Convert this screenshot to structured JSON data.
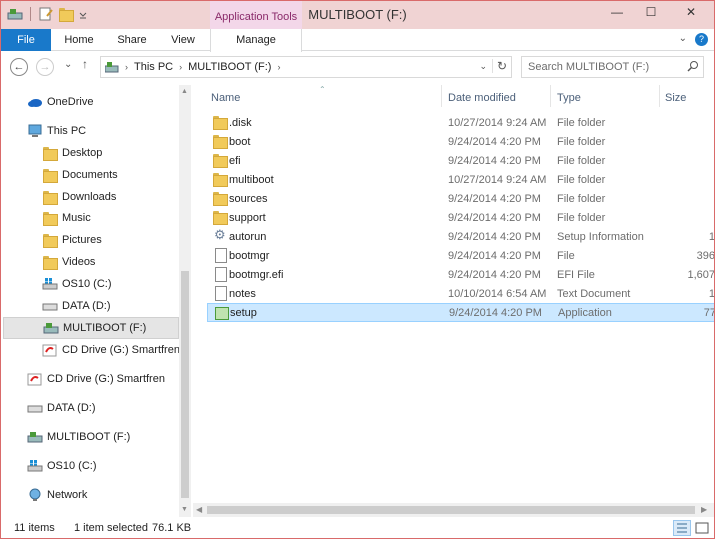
{
  "window": {
    "title": "MULTIBOOT (F:)",
    "context_tab_group": "Application Tools",
    "minimize": "—",
    "maximize": "☐",
    "close": "✕"
  },
  "ribbon": {
    "tabs": [
      "File",
      "Home",
      "Share",
      "View",
      "Manage"
    ],
    "collapse_icon": "⌄",
    "help_icon": "?"
  },
  "address": {
    "back": "←",
    "forward": "→",
    "recent": "⌄",
    "up": "↑",
    "crumbs": [
      "This PC",
      "MULTIBOOT (F:)"
    ],
    "crumb_sep": "›",
    "dropdown": "⌄",
    "refresh": "↻"
  },
  "search": {
    "placeholder": "Search MULTIBOOT (F:)"
  },
  "nav": {
    "items": [
      {
        "label": "OneDrive",
        "icon": "cloud-icon"
      },
      {
        "label": "This PC",
        "icon": "computer-icon"
      },
      {
        "label": "Desktop",
        "icon": "folder-icon"
      },
      {
        "label": "Documents",
        "icon": "folder-icon"
      },
      {
        "label": "Downloads",
        "icon": "folder-icon"
      },
      {
        "label": "Music",
        "icon": "folder-icon"
      },
      {
        "label": "Pictures",
        "icon": "folder-icon"
      },
      {
        "label": "Videos",
        "icon": "folder-icon"
      },
      {
        "label": "OS10 (C:)",
        "icon": "windows-drive-icon"
      },
      {
        "label": "DATA (D:)",
        "icon": "drive-icon"
      },
      {
        "label": "MULTIBOOT (F:)",
        "icon": "usb-drive-icon"
      },
      {
        "label": "CD Drive (G:) Smartfren",
        "icon": "cd-drive-icon"
      },
      {
        "label": "CD Drive (G:) Smartfren",
        "icon": "cd-drive-icon"
      },
      {
        "label": "DATA (D:)",
        "icon": "drive-icon"
      },
      {
        "label": "MULTIBOOT (F:)",
        "icon": "usb-drive-icon"
      },
      {
        "label": "OS10 (C:)",
        "icon": "windows-drive-icon"
      },
      {
        "label": "Network",
        "icon": "network-icon"
      }
    ]
  },
  "columns": {
    "name": "Name",
    "date": "Date modified",
    "type": "Type",
    "size": "Size"
  },
  "files": [
    {
      "name": ".disk",
      "date": "10/27/2014 9:24 AM",
      "type": "File folder",
      "size": "",
      "icon": "folder-icon"
    },
    {
      "name": "boot",
      "date": "9/24/2014 4:20 PM",
      "type": "File folder",
      "size": "",
      "icon": "folder-icon"
    },
    {
      "name": "efi",
      "date": "9/24/2014 4:20 PM",
      "type": "File folder",
      "size": "",
      "icon": "folder-icon"
    },
    {
      "name": "multiboot",
      "date": "10/27/2014 9:24 AM",
      "type": "File folder",
      "size": "",
      "icon": "folder-icon"
    },
    {
      "name": "sources",
      "date": "9/24/2014 4:20 PM",
      "type": "File folder",
      "size": "",
      "icon": "folder-icon"
    },
    {
      "name": "support",
      "date": "9/24/2014 4:20 PM",
      "type": "File folder",
      "size": "",
      "icon": "folder-icon"
    },
    {
      "name": "autorun",
      "date": "9/24/2014 4:20 PM",
      "type": "Setup Information",
      "size": "1",
      "icon": "settings-file-icon"
    },
    {
      "name": "bootmgr",
      "date": "9/24/2014 4:20 PM",
      "type": "File",
      "size": "396",
      "icon": "file-icon"
    },
    {
      "name": "bootmgr.efi",
      "date": "9/24/2014 4:20 PM",
      "type": "EFI File",
      "size": "1,607",
      "icon": "file-icon"
    },
    {
      "name": "notes",
      "date": "10/10/2014 6:54 AM",
      "type": "Text Document",
      "size": "1",
      "icon": "text-file-icon"
    },
    {
      "name": "setup",
      "date": "9/24/2014 4:20 PM",
      "type": "Application",
      "size": "77",
      "icon": "application-icon",
      "selected": true
    }
  ],
  "status": {
    "count": "11 items",
    "selection": "1 item selected",
    "selection_size": "76.1 KB"
  },
  "colors": {
    "title_bg": "#f0d3d3",
    "file_tab": "#1979ca",
    "context_tab": "#f3d7e9",
    "selection": "#cce8ff"
  }
}
